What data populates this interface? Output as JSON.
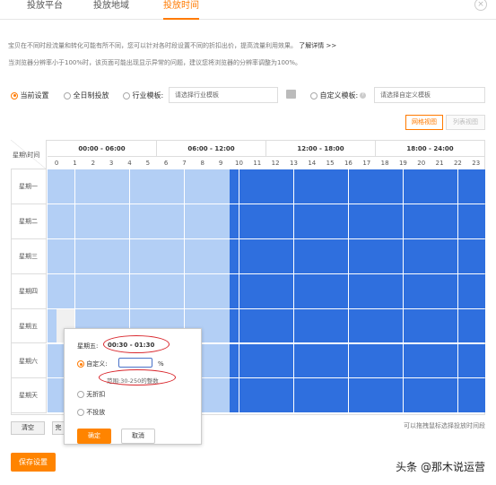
{
  "tabs": [
    "投放平台",
    "投放地域",
    "投放时间"
  ],
  "close_glyph": "×",
  "notice": {
    "line1": "宝贝在不同时段流量和转化可能有所不同，您可以针对各时段设置不同的折扣出价，提高流量利用效果。",
    "learn_more": "了解详情 >>",
    "line2": "当浏览器分辨率小于100%时，该页面可能出现显示异常的问题，建议您将浏览器的分辨率调整为100%。"
  },
  "options": {
    "current": "当前设置",
    "all_day": "全日制投放",
    "industry": "行业模板:",
    "industry_placeholder": "请选择行业模板",
    "custom": "自定义模板:",
    "custom_placeholder": "请选择自定义模板"
  },
  "views": {
    "grid": "网格视图",
    "list": "列表视图"
  },
  "grid": {
    "corner": "星期\\时间",
    "ranges": [
      "00:00 - 06:00",
      "06:00 - 12:00",
      "12:00 - 18:00",
      "18:00 - 24:00"
    ],
    "hours": [
      "0",
      "1",
      "2",
      "3",
      "4",
      "5",
      "6",
      "7",
      "8",
      "9",
      "10",
      "11",
      "12",
      "13",
      "14",
      "15",
      "16",
      "17",
      "18",
      "19",
      "20",
      "21",
      "22",
      "23"
    ],
    "days": [
      "星期一",
      "星期二",
      "星期三",
      "星期四",
      "星期五",
      "星期六",
      "星期天"
    ]
  },
  "bottom": {
    "clear": "清空",
    "second": "完",
    "hint": "可以拖拽鼠标选择投放时间段",
    "save": "保存设置"
  },
  "popup": {
    "day_label": "星期五:",
    "time_range": "00:30 - 01:30",
    "custom_label": "自定义:",
    "input_value": "",
    "unit": "%",
    "range_hint": "范围:30-250的整数",
    "no_discount": "无折扣",
    "no_delivery": "不投放",
    "confirm": "确定",
    "cancel": "取消"
  },
  "watermark": "头条 @那木说运营",
  "colors": {
    "accent": "#ff7a00",
    "cell_dark": "#2f6fde",
    "cell_light": "#b3cff5",
    "annotation": "#d9262c"
  }
}
